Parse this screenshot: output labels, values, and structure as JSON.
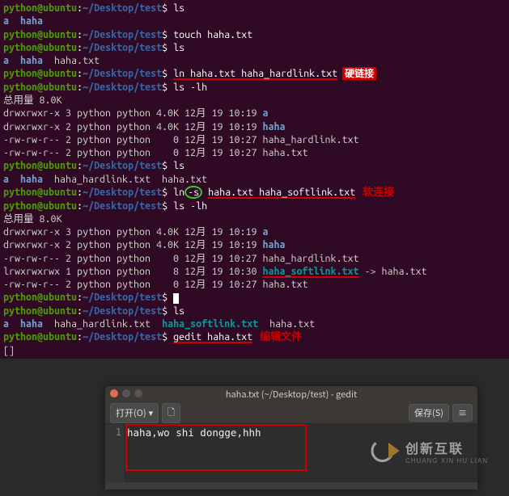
{
  "prompt": {
    "user": "python",
    "at": "@",
    "host": "ubuntu",
    "colon": ":",
    "path": "~/Desktop/test",
    "dollar": "$"
  },
  "blocks": [
    {
      "type": "prompt",
      "cmd": "ls"
    },
    {
      "type": "out",
      "parts": [
        {
          "cls": "dir",
          "t": "a"
        },
        {
          "cls": "txt",
          "t": "  "
        },
        {
          "cls": "dir",
          "t": "haha"
        }
      ]
    },
    {
      "type": "prompt",
      "cmd": "touch haha.txt"
    },
    {
      "type": "prompt",
      "cmd": "ls"
    },
    {
      "type": "out",
      "parts": [
        {
          "cls": "dir",
          "t": "a"
        },
        {
          "cls": "txt",
          "t": "  "
        },
        {
          "cls": "dir",
          "t": "haha"
        },
        {
          "cls": "txt",
          "t": "  haha.txt"
        }
      ]
    },
    {
      "type": "prompt",
      "cmd_ul": "ln haha.txt haha_hardlink.txt",
      "ann": "硬链接"
    },
    {
      "type": "prompt",
      "cmd": "ls -lh"
    },
    {
      "type": "out",
      "parts": [
        {
          "cls": "txt",
          "t": "总用量 8.0K"
        }
      ]
    },
    {
      "type": "out",
      "parts": [
        {
          "cls": "txt",
          "t": "drwxrwxr-x 3 python python 4.0K 12月 19 10:19 "
        },
        {
          "cls": "dir",
          "t": "a"
        }
      ]
    },
    {
      "type": "out",
      "parts": [
        {
          "cls": "txt",
          "t": "drwxrwxr-x 2 python python 4.0K 12月 19 10:19 "
        },
        {
          "cls": "dir",
          "t": "haha"
        }
      ]
    },
    {
      "type": "out",
      "parts": [
        {
          "cls": "txt",
          "t": "-rw-rw-r-- 2 python python    0 12月 19 10:27 haha_hardlink.txt"
        }
      ]
    },
    {
      "type": "out",
      "parts": [
        {
          "cls": "txt",
          "t": "-rw-rw-r-- 2 python python    0 12月 19 10:27 haha.txt"
        }
      ]
    },
    {
      "type": "prompt",
      "cmd": "ls"
    },
    {
      "type": "out",
      "parts": [
        {
          "cls": "dir",
          "t": "a"
        },
        {
          "cls": "txt",
          "t": "  "
        },
        {
          "cls": "dir",
          "t": "haha"
        },
        {
          "cls": "txt",
          "t": "  haha_hardlink.txt  haha.txt"
        }
      ]
    },
    {
      "type": "prompt",
      "cmd_pre": "ln",
      "circle": "-s",
      "cmd_post_ul": "haha.txt haha_softlink.txt",
      "ann2": "软连接"
    },
    {
      "type": "prompt",
      "cmd": "ls -lh"
    },
    {
      "type": "out",
      "parts": [
        {
          "cls": "txt",
          "t": "总用量 8.0K"
        }
      ]
    },
    {
      "type": "out",
      "parts": [
        {
          "cls": "txt",
          "t": "drwxrwxr-x 3 python python 4.0K 12月 19 10:19 "
        },
        {
          "cls": "dir",
          "t": "a"
        }
      ]
    },
    {
      "type": "out",
      "parts": [
        {
          "cls": "txt",
          "t": "drwxrwxr-x 2 python python 4.0K 12月 19 10:19 "
        },
        {
          "cls": "dir",
          "t": "haha"
        }
      ]
    },
    {
      "type": "out",
      "parts": [
        {
          "cls": "txt",
          "t": "-rw-rw-r-- 2 python python    0 12月 19 10:27 haha_hardlink.txt"
        }
      ]
    },
    {
      "type": "out",
      "parts": [
        {
          "cls": "txt",
          "t": "lrwxrwxrwx 1 python python    8 12月 19 10:30 "
        },
        {
          "cls": "link hl-under",
          "t": "haha_softlink.txt"
        },
        {
          "cls": "txt",
          "t": " -> haha.txt"
        }
      ]
    },
    {
      "type": "out",
      "parts": [
        {
          "cls": "txt",
          "t": "-rw-rw-r-- 2 python python    0 12月 19 10:27 haha.txt"
        }
      ]
    },
    {
      "type": "prompt",
      "cmd": "",
      "cursor": true
    },
    {
      "type": "prompt",
      "cmd": "ls"
    },
    {
      "type": "out",
      "parts": [
        {
          "cls": "dir",
          "t": "a"
        },
        {
          "cls": "txt",
          "t": "  "
        },
        {
          "cls": "dir",
          "t": "haha"
        },
        {
          "cls": "txt",
          "t": "  haha_hardlink.txt  "
        },
        {
          "cls": "link",
          "t": "haha_softlink.txt"
        },
        {
          "cls": "txt",
          "t": "  haha.txt"
        }
      ]
    },
    {
      "type": "prompt",
      "cmd_ul": "gedit haha.txt",
      "ann2": "编辑文件"
    },
    {
      "type": "out",
      "parts": [
        {
          "cls": "txt",
          "t": "[]"
        }
      ]
    }
  ],
  "gedit": {
    "title": "haha.txt (~/Desktop/test) - gedit",
    "open": "打开(O)",
    "down": "▾",
    "new_icon": "🗋",
    "save": "保存(S)",
    "menu": "≡",
    "line_no": "1",
    "content": "haha,wo shi  dongge,hhh"
  },
  "watermark": {
    "cn": "创新互联",
    "en": "CHUANG XIN HU LIAN"
  }
}
